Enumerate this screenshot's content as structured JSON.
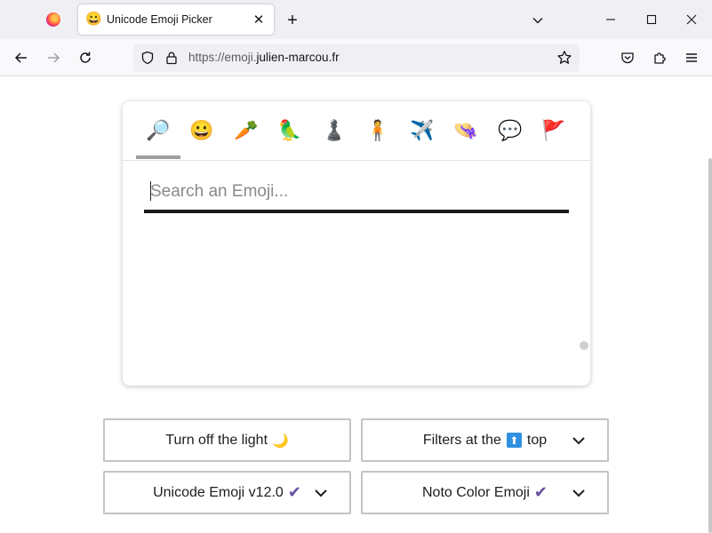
{
  "browser": {
    "tab": {
      "favicon": "😀",
      "title": "Unicode Emoji Picker",
      "close": "✕"
    },
    "new_tab": "+",
    "url": {
      "prefix": "https://emoji.",
      "domain": "julien-marcou.fr"
    }
  },
  "picker": {
    "categories": [
      {
        "name": "search",
        "emoji": "🔎"
      },
      {
        "name": "smileys",
        "emoji": "😀"
      },
      {
        "name": "food",
        "emoji": "🥕"
      },
      {
        "name": "animals",
        "emoji": "🦜"
      },
      {
        "name": "activities",
        "emoji": "♟️"
      },
      {
        "name": "people",
        "emoji": "🧍"
      },
      {
        "name": "travel",
        "emoji": "✈️"
      },
      {
        "name": "objects",
        "emoji": "👒"
      },
      {
        "name": "symbols",
        "emoji": "💬"
      },
      {
        "name": "flags",
        "emoji": "🚩"
      }
    ],
    "search_placeholder": "Search an Emoji..."
  },
  "options": {
    "theme_label": "Turn off the light",
    "theme_emoji": "🌙",
    "filters_prefix": "Filters at the",
    "filters_icon": "⬆",
    "filters_suffix": "top",
    "version_label": "Unicode Emoji v12.0",
    "font_label": "Noto Color Emoji",
    "check": "✔"
  },
  "colors": {
    "check": "#6a4fa0",
    "up_box": "#2f8fe0"
  }
}
